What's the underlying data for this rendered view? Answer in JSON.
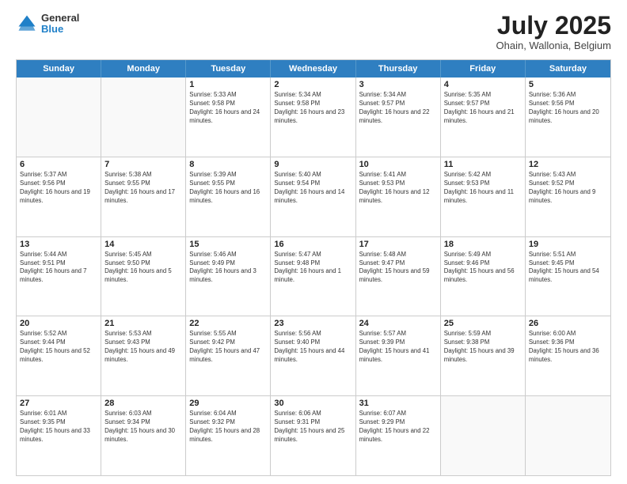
{
  "header": {
    "logo": {
      "line1": "General",
      "line2": "Blue"
    },
    "title": "July 2025",
    "location": "Ohain, Wallonia, Belgium"
  },
  "weekdays": [
    "Sunday",
    "Monday",
    "Tuesday",
    "Wednesday",
    "Thursday",
    "Friday",
    "Saturday"
  ],
  "rows": [
    [
      {
        "day": "",
        "info": ""
      },
      {
        "day": "",
        "info": ""
      },
      {
        "day": "1",
        "info": "Sunrise: 5:33 AM\nSunset: 9:58 PM\nDaylight: 16 hours and 24 minutes."
      },
      {
        "day": "2",
        "info": "Sunrise: 5:34 AM\nSunset: 9:58 PM\nDaylight: 16 hours and 23 minutes."
      },
      {
        "day": "3",
        "info": "Sunrise: 5:34 AM\nSunset: 9:57 PM\nDaylight: 16 hours and 22 minutes."
      },
      {
        "day": "4",
        "info": "Sunrise: 5:35 AM\nSunset: 9:57 PM\nDaylight: 16 hours and 21 minutes."
      },
      {
        "day": "5",
        "info": "Sunrise: 5:36 AM\nSunset: 9:56 PM\nDaylight: 16 hours and 20 minutes."
      }
    ],
    [
      {
        "day": "6",
        "info": "Sunrise: 5:37 AM\nSunset: 9:56 PM\nDaylight: 16 hours and 19 minutes."
      },
      {
        "day": "7",
        "info": "Sunrise: 5:38 AM\nSunset: 9:55 PM\nDaylight: 16 hours and 17 minutes."
      },
      {
        "day": "8",
        "info": "Sunrise: 5:39 AM\nSunset: 9:55 PM\nDaylight: 16 hours and 16 minutes."
      },
      {
        "day": "9",
        "info": "Sunrise: 5:40 AM\nSunset: 9:54 PM\nDaylight: 16 hours and 14 minutes."
      },
      {
        "day": "10",
        "info": "Sunrise: 5:41 AM\nSunset: 9:53 PM\nDaylight: 16 hours and 12 minutes."
      },
      {
        "day": "11",
        "info": "Sunrise: 5:42 AM\nSunset: 9:53 PM\nDaylight: 16 hours and 11 minutes."
      },
      {
        "day": "12",
        "info": "Sunrise: 5:43 AM\nSunset: 9:52 PM\nDaylight: 16 hours and 9 minutes."
      }
    ],
    [
      {
        "day": "13",
        "info": "Sunrise: 5:44 AM\nSunset: 9:51 PM\nDaylight: 16 hours and 7 minutes."
      },
      {
        "day": "14",
        "info": "Sunrise: 5:45 AM\nSunset: 9:50 PM\nDaylight: 16 hours and 5 minutes."
      },
      {
        "day": "15",
        "info": "Sunrise: 5:46 AM\nSunset: 9:49 PM\nDaylight: 16 hours and 3 minutes."
      },
      {
        "day": "16",
        "info": "Sunrise: 5:47 AM\nSunset: 9:48 PM\nDaylight: 16 hours and 1 minute."
      },
      {
        "day": "17",
        "info": "Sunrise: 5:48 AM\nSunset: 9:47 PM\nDaylight: 15 hours and 59 minutes."
      },
      {
        "day": "18",
        "info": "Sunrise: 5:49 AM\nSunset: 9:46 PM\nDaylight: 15 hours and 56 minutes."
      },
      {
        "day": "19",
        "info": "Sunrise: 5:51 AM\nSunset: 9:45 PM\nDaylight: 15 hours and 54 minutes."
      }
    ],
    [
      {
        "day": "20",
        "info": "Sunrise: 5:52 AM\nSunset: 9:44 PM\nDaylight: 15 hours and 52 minutes."
      },
      {
        "day": "21",
        "info": "Sunrise: 5:53 AM\nSunset: 9:43 PM\nDaylight: 15 hours and 49 minutes."
      },
      {
        "day": "22",
        "info": "Sunrise: 5:55 AM\nSunset: 9:42 PM\nDaylight: 15 hours and 47 minutes."
      },
      {
        "day": "23",
        "info": "Sunrise: 5:56 AM\nSunset: 9:40 PM\nDaylight: 15 hours and 44 minutes."
      },
      {
        "day": "24",
        "info": "Sunrise: 5:57 AM\nSunset: 9:39 PM\nDaylight: 15 hours and 41 minutes."
      },
      {
        "day": "25",
        "info": "Sunrise: 5:59 AM\nSunset: 9:38 PM\nDaylight: 15 hours and 39 minutes."
      },
      {
        "day": "26",
        "info": "Sunrise: 6:00 AM\nSunset: 9:36 PM\nDaylight: 15 hours and 36 minutes."
      }
    ],
    [
      {
        "day": "27",
        "info": "Sunrise: 6:01 AM\nSunset: 9:35 PM\nDaylight: 15 hours and 33 minutes."
      },
      {
        "day": "28",
        "info": "Sunrise: 6:03 AM\nSunset: 9:34 PM\nDaylight: 15 hours and 30 minutes."
      },
      {
        "day": "29",
        "info": "Sunrise: 6:04 AM\nSunset: 9:32 PM\nDaylight: 15 hours and 28 minutes."
      },
      {
        "day": "30",
        "info": "Sunrise: 6:06 AM\nSunset: 9:31 PM\nDaylight: 15 hours and 25 minutes."
      },
      {
        "day": "31",
        "info": "Sunrise: 6:07 AM\nSunset: 9:29 PM\nDaylight: 15 hours and 22 minutes."
      },
      {
        "day": "",
        "info": ""
      },
      {
        "day": "",
        "info": ""
      }
    ]
  ]
}
